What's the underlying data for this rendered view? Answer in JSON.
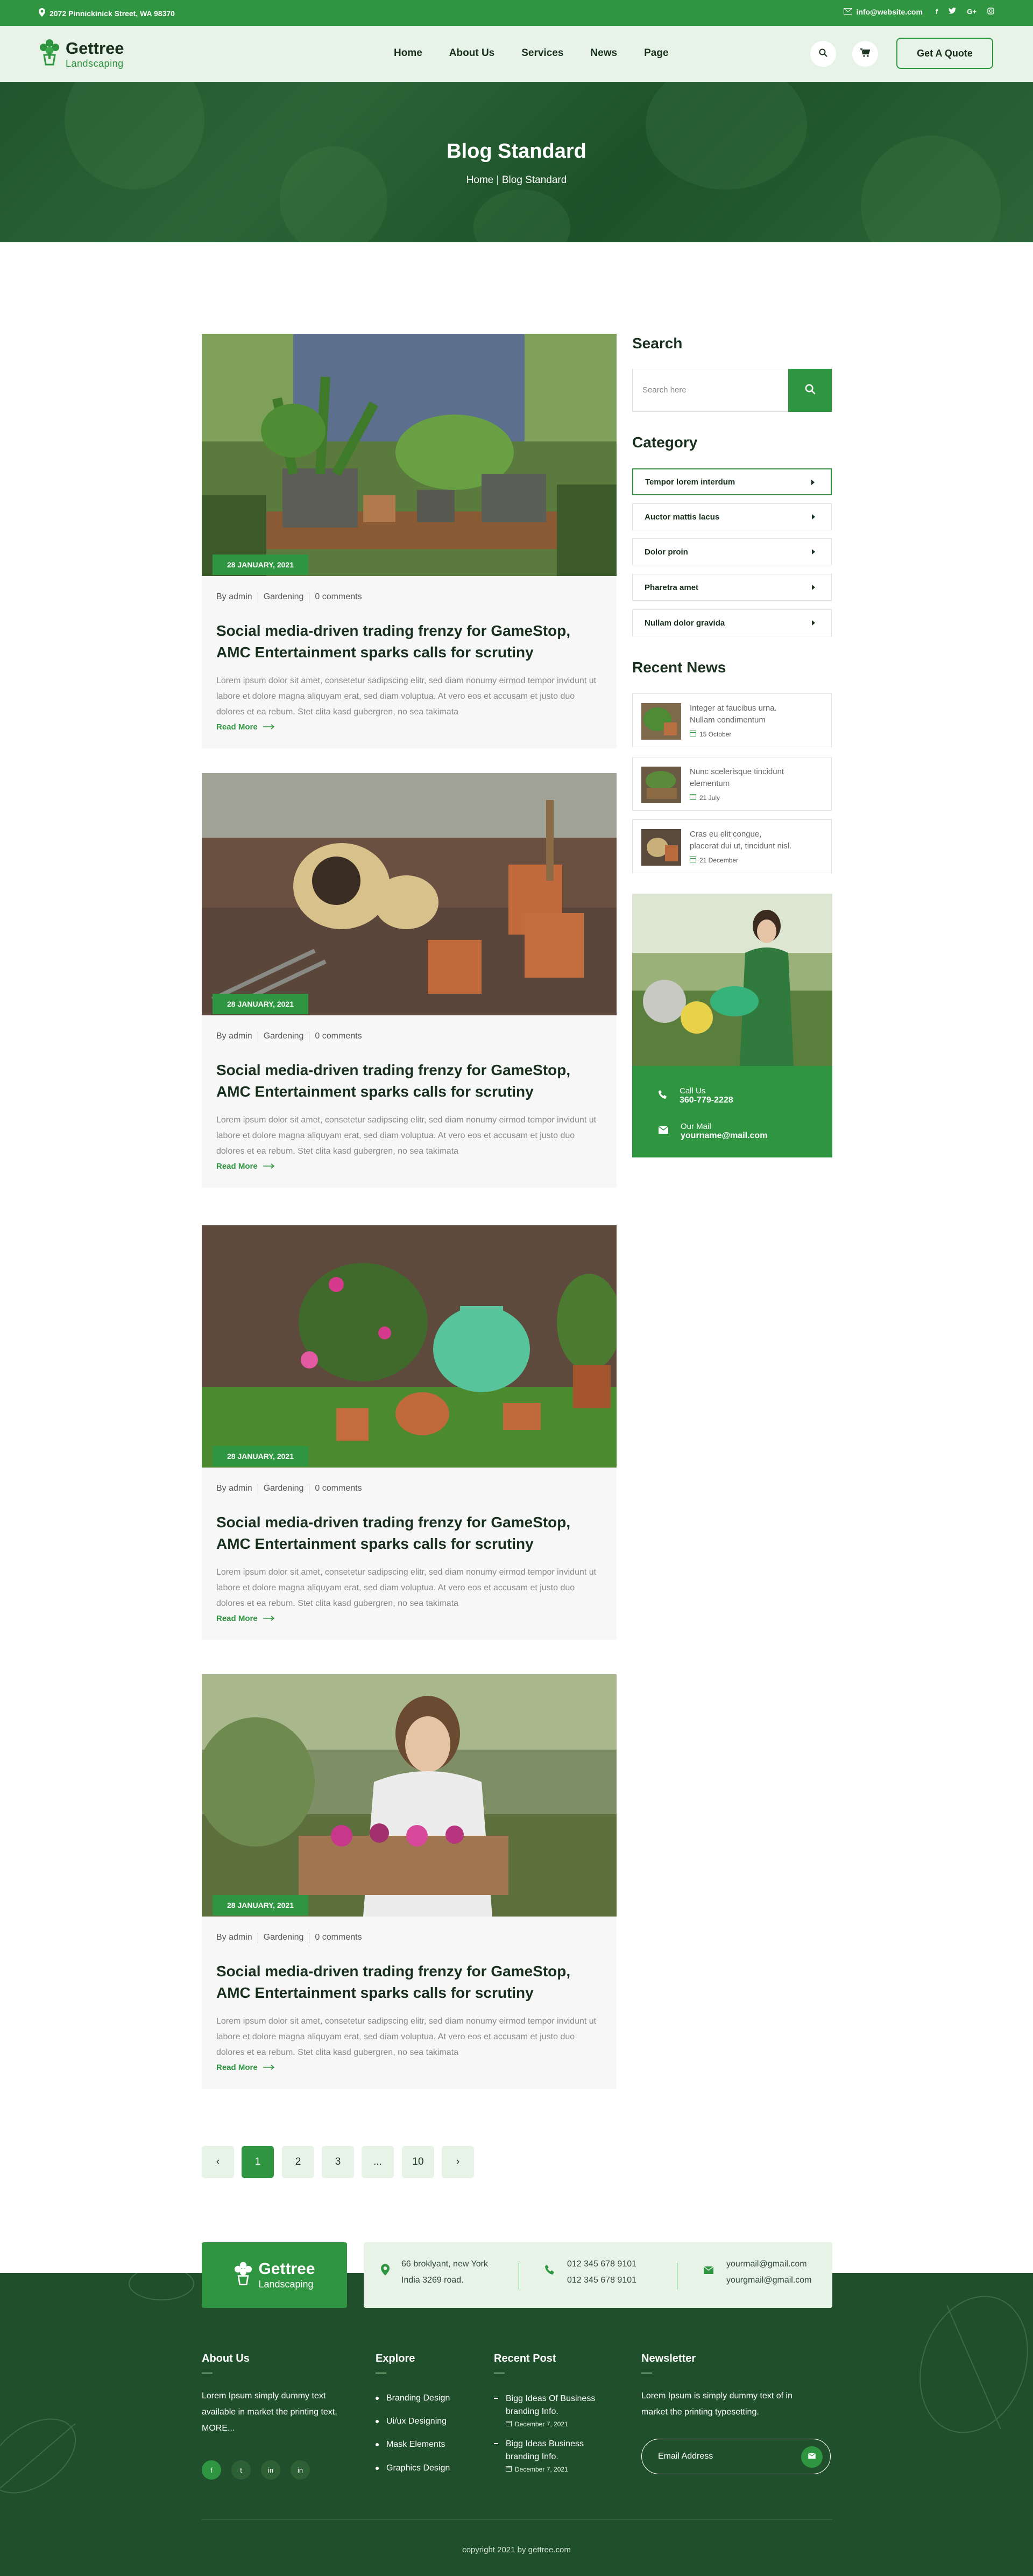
{
  "topbar": {
    "address": "2072 Pinnickinick Street, WA 98370",
    "email": "info@website.com",
    "socials": [
      "f",
      "t",
      "G+",
      "in"
    ]
  },
  "header": {
    "logo_name": "Gettree",
    "logo_tag": "Landscaping",
    "nav": [
      "Home",
      "About Us",
      "Services",
      "News",
      "Page"
    ],
    "quote_button": "Get A Quote"
  },
  "hero": {
    "title": "Blog Standard",
    "breadcrumb_home": "Home",
    "breadcrumb_current": "Blog Standard"
  },
  "posts": [
    {
      "date": "28 JANUARY, 2021",
      "author": "By admin",
      "category": "Gardening",
      "comments": "0 comments",
      "title": "Social media-driven trading frenzy for GameStop, AMC Entertainment sparks calls for scrutiny",
      "excerpt": "Lorem ipsum dolor sit amet, consetetur sadipscing elitr, sed diam nonumy eirmod tempor invidunt ut labore et dolore magna aliquyam erat, sed diam voluptua. At vero eos et accusam et justo duo dolores et ea rebum. Stet clita kasd gubergren, no sea takimata",
      "more": "Read More"
    },
    {
      "date": "28 JANUARY, 2021",
      "author": "By admin",
      "category": "Gardening",
      "comments": "0 comments",
      "title": "Social media-driven trading frenzy for GameStop, AMC Entertainment sparks calls for scrutiny",
      "excerpt": "Lorem ipsum dolor sit amet, consetetur sadipscing elitr, sed diam nonumy eirmod tempor invidunt ut labore et dolore magna aliquyam erat, sed diam voluptua. At vero eos et accusam et justo duo dolores et ea rebum. Stet clita kasd gubergren, no sea takimata",
      "more": "Read More"
    },
    {
      "date": "28 JANUARY, 2021",
      "author": "By admin",
      "category": "Gardening",
      "comments": "0 comments",
      "title": "Social media-driven trading frenzy for GameStop, AMC Entertainment sparks calls for scrutiny",
      "excerpt": "Lorem ipsum dolor sit amet, consetetur sadipscing elitr, sed diam nonumy eirmod tempor invidunt ut labore et dolore magna aliquyam erat, sed diam voluptua. At vero eos et accusam et justo duo dolores et ea rebum. Stet clita kasd gubergren, no sea takimata",
      "more": "Read More"
    },
    {
      "date": "28 JANUARY, 2021",
      "author": "By admin",
      "category": "Gardening",
      "comments": "0 comments",
      "title": "Social media-driven trading frenzy for GameStop, AMC Entertainment sparks calls for scrutiny",
      "excerpt": "Lorem ipsum dolor sit amet, consetetur sadipscing elitr, sed diam nonumy eirmod tempor invidunt ut labore et dolore magna aliquyam erat, sed diam voluptua. At vero eos et accusam et justo duo dolores et ea rebum. Stet clita kasd gubergren, no sea takimata",
      "more": "Read More"
    }
  ],
  "sidebar": {
    "search_title": "Search",
    "search_placeholder": "Search here",
    "category_title": "Category",
    "categories": [
      "Tempor lorem interdum",
      "Auctor mattis lacus",
      "Dolor proin",
      "Pharetra amet",
      "Nullam dolor gravida"
    ],
    "news_title": "Recent News",
    "news": [
      {
        "text": "Integer at faucibus urna. Nullam condimentum",
        "date": "15 October"
      },
      {
        "text": "Nunc scelerisque tincidunt elementum",
        "date": "21 July"
      },
      {
        "text": "Cras eu elit congue, placerat dui ut, tincidunt nisl.",
        "date": "21 December"
      }
    ],
    "call_label": "Call Us",
    "call_value": "360-779-2228",
    "mail_label": "Our Mail",
    "mail_value": "yourname@mail.com"
  },
  "pagination": {
    "prev": "‹",
    "pages": [
      "1",
      "2",
      "3",
      "...",
      "10"
    ],
    "next": "›",
    "active": "1"
  },
  "footer": {
    "logo_name": "Gettree",
    "logo_tag": "Landscaping",
    "address_line1": "66 broklyant, new York",
    "address_line2": "India 3269 road.",
    "phone1": "012 345 678 9101",
    "phone2": "012 345 678 9101",
    "email1": "yourmail@gmail.com",
    "email2": "yourgmail@gmail.com",
    "about_title": "About  Us",
    "about_text": "Lorem Ipsum simply dummy text available in market the printing text, MORE...",
    "socials": [
      "f",
      "t",
      "in",
      "in"
    ],
    "explore_title": "Explore",
    "explore_links": [
      "Branding Design",
      "Ui/ux Designing",
      "Mask Elements",
      "Graphics Design"
    ],
    "recent_title": "Recent Post",
    "recent_posts": [
      {
        "title": "Bigg Ideas Of Business branding Info.",
        "date": "December 7, 2021"
      },
      {
        "title": "Bigg Ideas Business branding Info.",
        "date": "December 7, 2021"
      }
    ],
    "newsletter_title": "Newsletter",
    "newsletter_text": "Lorem Ipsum is simply dummy text of in market the printing typesetting.",
    "email_placeholder": "Email Address",
    "copyright": "copyright 2021 by gettree.com"
  },
  "colors": {
    "primary": "#2f9540",
    "dark": "#18301d",
    "light_green": "#e7f3e6",
    "footer": "#1f4f2b"
  }
}
